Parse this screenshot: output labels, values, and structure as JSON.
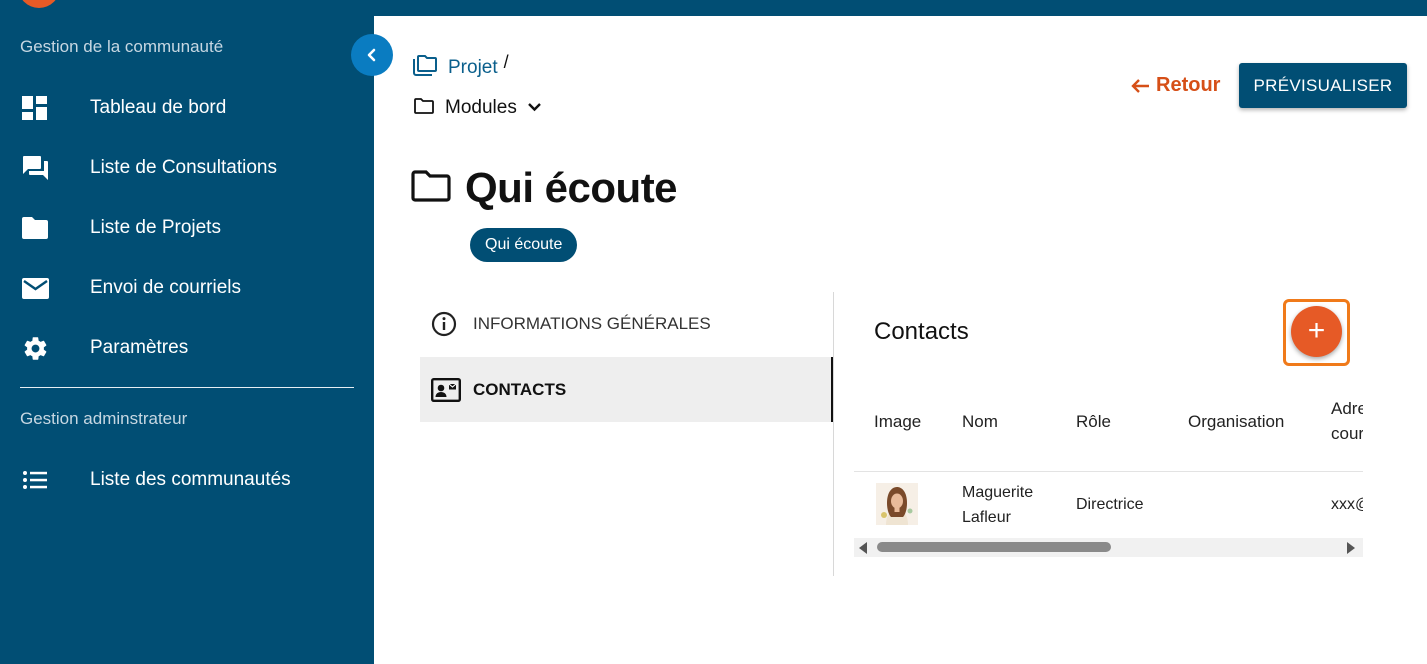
{
  "sidebar": {
    "section_community": "Gestion de la communauté",
    "items": [
      {
        "label": "Tableau de bord",
        "icon": "dashboard-icon"
      },
      {
        "label": "Liste de Consultations",
        "icon": "forum-icon"
      },
      {
        "label": "Liste de Projets",
        "icon": "folder-icon"
      },
      {
        "label": "Envoi de courriels",
        "icon": "mail-icon"
      },
      {
        "label": "Paramètres",
        "icon": "gear-icon"
      }
    ],
    "section_admin": "Gestion adminstrateur",
    "admin_items": [
      {
        "label": "Liste des communautés",
        "icon": "list-icon"
      }
    ]
  },
  "breadcrumb": {
    "projet": "Projet",
    "separator": "/",
    "modules": "Modules"
  },
  "header": {
    "back_label": "Retour",
    "preview_label": "PRÉVISUALISER"
  },
  "page": {
    "title": "Qui écoute",
    "chip": "Qui écoute"
  },
  "tabs": [
    {
      "label": "INFORMATIONS GÉNÉRALES",
      "icon": "info-icon",
      "active": false
    },
    {
      "label": "CONTACTS",
      "icon": "contact-card-icon",
      "active": true
    }
  ],
  "contacts": {
    "title": "Contacts",
    "add_label": "+",
    "columns": [
      "Image",
      "Nom",
      "Rôle",
      "Organisation",
      "Adresse courriel"
    ],
    "rows": [
      {
        "name_line1": "Maguerite",
        "name_line2": "Lafleur",
        "role": "Directrice",
        "organisation": "",
        "email": "xxx@"
      }
    ]
  },
  "colors": {
    "primary": "#014e74",
    "accent": "#e65a26",
    "link": "#0a5f8c",
    "back": "#d64f17"
  }
}
